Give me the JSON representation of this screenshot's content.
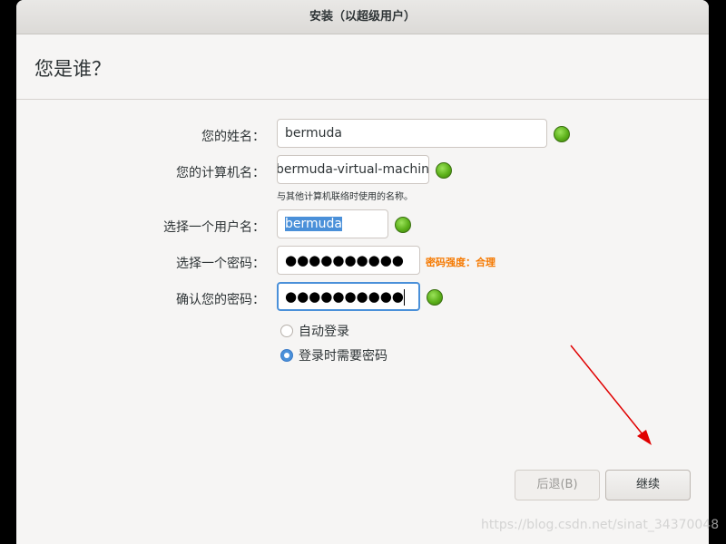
{
  "window": {
    "title": "安装（以超级用户）"
  },
  "page": {
    "heading": "您是谁？"
  },
  "form": {
    "name_label": "您的姓名：",
    "name_value": "bermuda",
    "computer_label": "您的计算机名：",
    "computer_value": "bermuda-virtual-machine",
    "computer_hint": "与其他计算机联络时使用的名称。",
    "username_label": "选择一个用户名：",
    "username_value": "bermuda",
    "password_label": "选择一个密码：",
    "password_mask": "●●●●●●●●●●",
    "password_strength": "密码强度：合理",
    "confirm_label": "确认您的密码：",
    "confirm_mask": "●●●●●●●●●●",
    "auto_login_label": "自动登录",
    "require_password_label": "登录时需要密码",
    "selected_option": "require_password"
  },
  "buttons": {
    "back_label": "后退(B)",
    "continue_label": "继续"
  },
  "watermark": "https://blog.csdn.net/sinat_34370048",
  "colors": {
    "accent": "#4a90d9",
    "ok_indicator": "#5cb01a",
    "strength_text": "#f57900",
    "annotation_arrow": "#e00000"
  },
  "icons": [
    "check-ok-icon",
    "radio-icon",
    "arrow-annotation"
  ]
}
